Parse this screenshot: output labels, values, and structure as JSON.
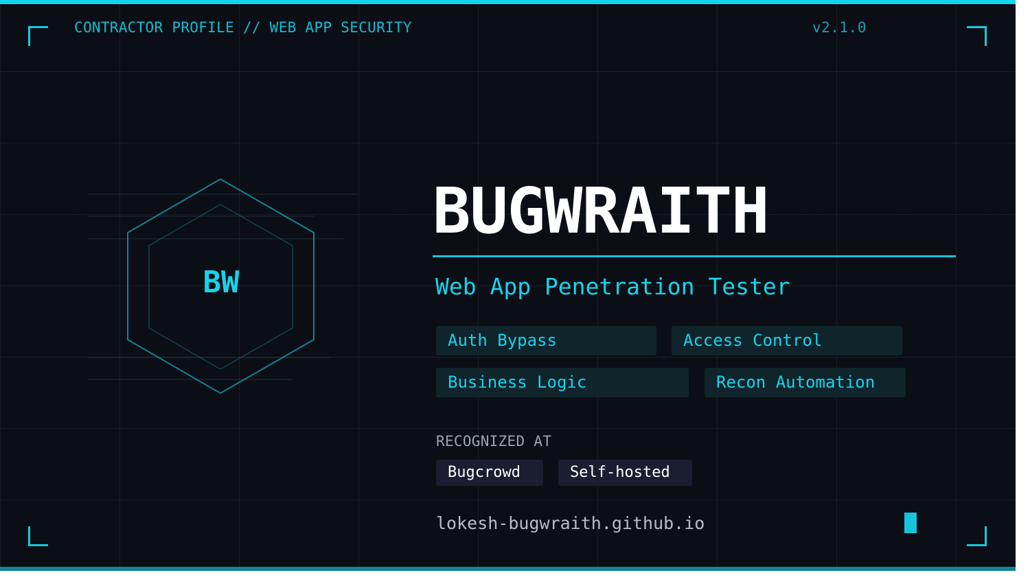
{
  "header": {
    "label": "CONTRACTOR PROFILE // WEB APP SECURITY",
    "version": "v2.1.0"
  },
  "emblem": {
    "initials": "BW"
  },
  "profile": {
    "name": "BUGWRAITH",
    "role": "Web App Penetration Tester"
  },
  "skills": [
    "Auth Bypass",
    "Access Control",
    "Business Logic",
    "Recon Automation"
  ],
  "recognition": {
    "heading": "RECOGNIZED AT",
    "items": [
      "Bugcrowd",
      "Self-hosted"
    ]
  },
  "footer": {
    "url": "lokesh-bugwraith.github.io"
  },
  "colors": {
    "background": "#0c0e15",
    "accent": "#16d4ec",
    "title": "#ffffff",
    "chip_background": "#10242c",
    "badge_background": "#1a1e30"
  }
}
